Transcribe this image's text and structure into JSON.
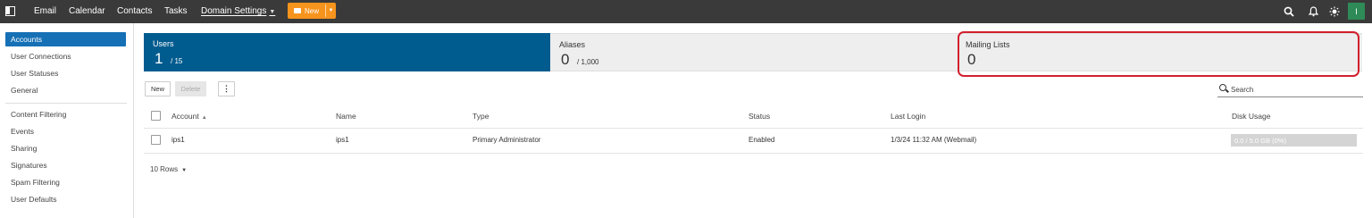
{
  "topbar": {
    "nav": [
      "Email",
      "Calendar",
      "Contacts",
      "Tasks",
      "Domain Settings"
    ],
    "new_label": "New",
    "avatar_initial": "I",
    "icons": [
      "search-icon",
      "bell-icon",
      "sun-icon"
    ]
  },
  "sidebar": {
    "items": [
      {
        "label": "Accounts"
      },
      {
        "label": "User Connections"
      },
      {
        "label": "User Statuses"
      },
      {
        "label": "General"
      },
      {
        "label": "Content Filtering"
      },
      {
        "label": "Events"
      },
      {
        "label": "Sharing"
      },
      {
        "label": "Signatures"
      },
      {
        "label": "Spam Filtering"
      },
      {
        "label": "User Defaults"
      }
    ]
  },
  "stats": {
    "users": {
      "label": "Users",
      "count": "1",
      "of": "/ 15"
    },
    "aliases": {
      "label": "Aliases",
      "count": "0",
      "of": "/ 1,000"
    },
    "lists": {
      "label": "Mailing Lists",
      "count": "0"
    }
  },
  "toolbar": {
    "new_label": "New",
    "delete_label": "Delete",
    "more_label": "⋮",
    "search_placeholder": "Search"
  },
  "table": {
    "headers": [
      "Account",
      "Name",
      "Type",
      "Status",
      "Last Login",
      "Disk Usage"
    ],
    "rows": [
      {
        "account": "ips1",
        "name": "ips1",
        "type": "Primary Administrator",
        "status": "Enabled",
        "last_login": "1/3/24 11:32 AM (Webmail)",
        "disk_usage": "0.0 / 5.0 GB (0%)",
        "disk_fraction": 0.0
      }
    ],
    "rows_per_page": "10 Rows"
  },
  "colors": {
    "topbar": "#3a3a3a",
    "accent": "#1670b5",
    "users_card": "#005b8e",
    "new_button": "#f7941d",
    "highlight": "#d21f2d"
  }
}
